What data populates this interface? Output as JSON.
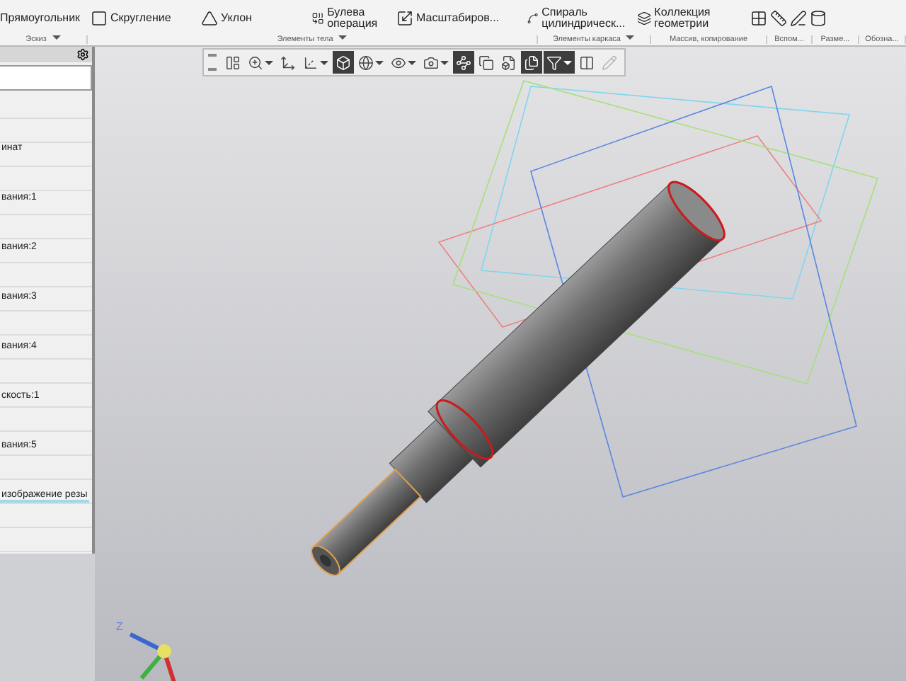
{
  "ribbon": {
    "commands": [
      {
        "kind": "text",
        "label": "Прямоугольник"
      },
      {
        "kind": "icon",
        "label": "Скругление"
      },
      {
        "kind": "icon",
        "label": "Уклон"
      },
      {
        "kind": "icon",
        "label": "Булева операция"
      },
      {
        "kind": "icon",
        "label": "Масштабиров..."
      },
      {
        "kind": "icon",
        "label": "Спираль цилиндрическ..."
      },
      {
        "kind": "icon",
        "label": "Коллекция геометрии"
      },
      {
        "kind": "tools"
      }
    ],
    "groups": [
      {
        "label": "Эскиз",
        "dropdown": true
      },
      {
        "label": "Элементы тела",
        "dropdown": true
      },
      {
        "label": "Элементы каркаса",
        "dropdown": true
      },
      {
        "label": "Массив, копирование"
      },
      {
        "label": "Вспом..."
      },
      {
        "label": "Разме..."
      },
      {
        "label": "Обозна..."
      }
    ]
  },
  "tree": {
    "items": [
      {
        "label": "инат",
        "selected": false
      },
      {
        "label": "вания:1",
        "selected": false
      },
      {
        "label": "вания:2",
        "selected": false
      },
      {
        "label": "вания:3",
        "selected": false
      },
      {
        "label": "вания:4",
        "selected": false
      },
      {
        "label": "скость:1",
        "selected": false
      },
      {
        "label": "вания:5",
        "selected": false
      },
      {
        "label": "изображение резы",
        "selected": true
      }
    ]
  },
  "view_toolbar": {
    "buttons": [
      {
        "selected": false,
        "dropdown": false,
        "disabled": false
      },
      {
        "selected": false,
        "dropdown": true,
        "disabled": false
      },
      {
        "selected": false,
        "dropdown": false,
        "disabled": false
      },
      {
        "selected": false,
        "dropdown": true,
        "disabled": false
      },
      {
        "selected": true,
        "dropdown": false,
        "disabled": false
      },
      {
        "selected": false,
        "dropdown": true,
        "disabled": false
      },
      {
        "selected": false,
        "dropdown": true,
        "disabled": false
      },
      {
        "selected": false,
        "dropdown": true,
        "disabled": false
      },
      {
        "selected": true,
        "dropdown": false,
        "disabled": false
      },
      {
        "selected": false,
        "dropdown": false,
        "disabled": false
      },
      {
        "selected": false,
        "dropdown": false,
        "disabled": false
      },
      {
        "selected": true,
        "dropdown": false,
        "disabled": false
      },
      {
        "selected": true,
        "dropdown": true,
        "disabled": false
      },
      {
        "selected": false,
        "dropdown": false,
        "disabled": false
      },
      {
        "selected": false,
        "dropdown": false,
        "disabled": true
      }
    ]
  },
  "triad": {
    "axis_label": "Z"
  }
}
